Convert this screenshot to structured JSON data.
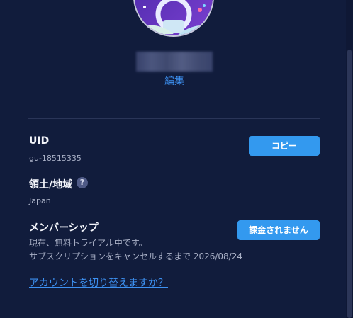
{
  "profile": {
    "edit_label": "編集"
  },
  "uid": {
    "label": "UID",
    "value": "gu-18515335",
    "copy_button": "コピー"
  },
  "region": {
    "label": "領土/地域",
    "value": "Japan",
    "help_glyph": "?"
  },
  "membership": {
    "label": "メンバーシップ",
    "status_line": "現在、無料トライアル中です。",
    "cancel_line": "サブスクリプションをキャンセルするまで 2026/08/24",
    "billing_button": "課金されません"
  },
  "switch_account_link": "アカウントを切り替えますか？",
  "colors": {
    "background": "#111c3c",
    "accent": "#3399ef",
    "link": "#3d91f2"
  }
}
